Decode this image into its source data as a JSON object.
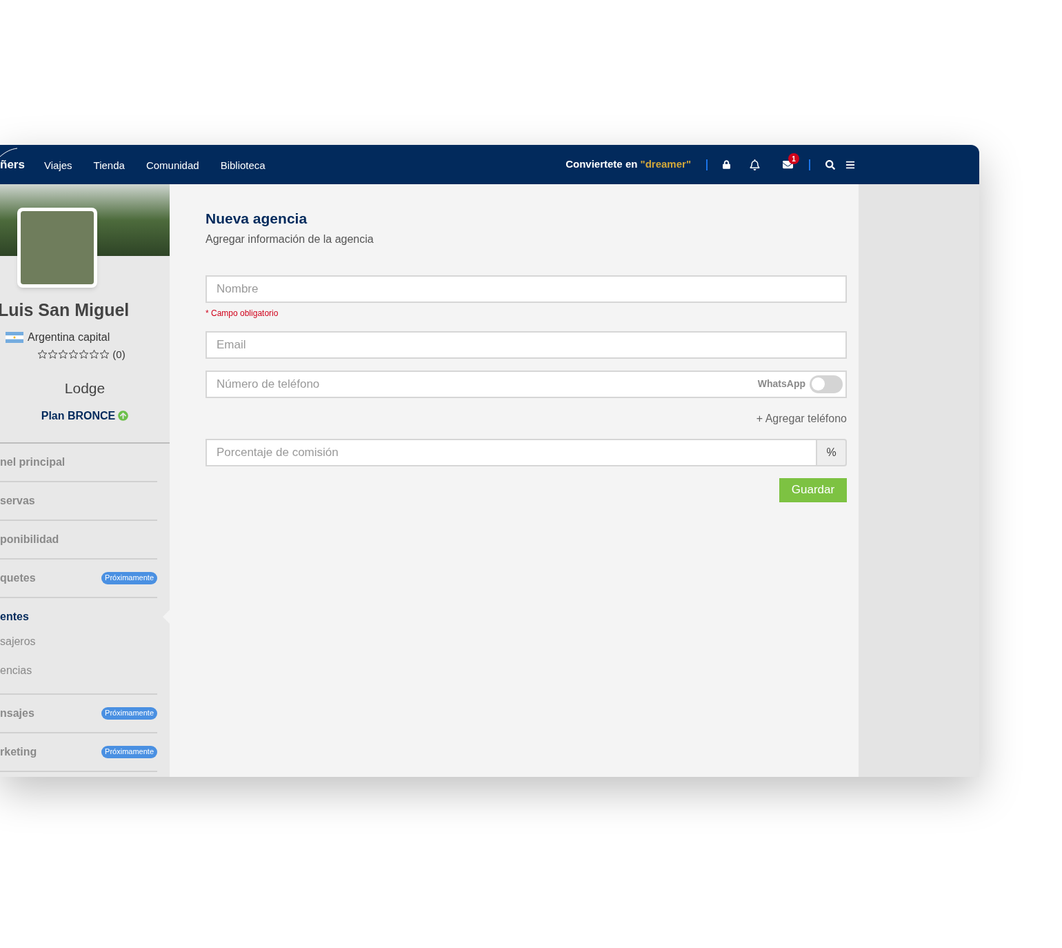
{
  "navbar": {
    "logo_text": "ñers",
    "links": [
      {
        "label": "Viajes"
      },
      {
        "label": "Tienda"
      },
      {
        "label": "Comunidad"
      },
      {
        "label": "Biblioteca"
      }
    ],
    "cta_text": "Conviertete en",
    "cta_highlight": "\"dreamer\"",
    "mail_badge": "1"
  },
  "profile": {
    "name": "Luis San Miguel",
    "location": "Argentina capital",
    "stars": 0,
    "review_count": "(0)",
    "type": "Lodge",
    "plan": "Plan BRONCE"
  },
  "sidebar": {
    "items": [
      {
        "label": "nel principal",
        "selected": false
      },
      {
        "label": "servas",
        "selected": false
      },
      {
        "label": "ponibilidad",
        "selected": false
      },
      {
        "label": "quetes",
        "selected": false,
        "badge": "Próximamente"
      },
      {
        "label": "entes",
        "selected": true,
        "children": [
          {
            "label": "sajeros"
          },
          {
            "label": "encias"
          }
        ]
      },
      {
        "label": "nsajes",
        "selected": false,
        "badge": "Próximamente"
      },
      {
        "label": "rketing",
        "selected": false,
        "badge": "Próximamente"
      }
    ]
  },
  "form": {
    "title": "Nueva agencia",
    "subtitle": "Agregar información de la agencia",
    "name_field": {
      "placeholder": "Nombre",
      "error": "* Campo obligatorio"
    },
    "email_field": {
      "placeholder": "Email"
    },
    "phone_field": {
      "placeholder": "Número de teléfono",
      "whatsapp_label": "WhatsApp",
      "whatsapp_on": false
    },
    "add_phone": "+ Agregar teléfono",
    "commission_field": {
      "placeholder": "Porcentaje de comisión",
      "suffix": "%"
    },
    "save_button": "Guardar"
  }
}
